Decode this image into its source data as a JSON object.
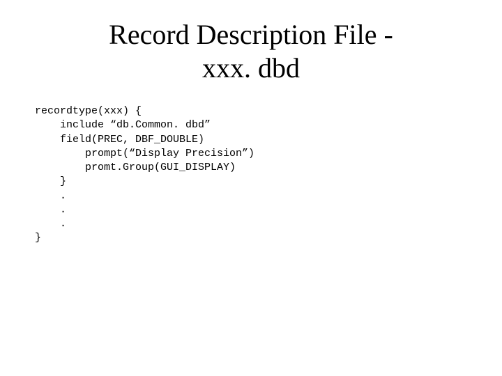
{
  "title_line1": "Record Description File -",
  "title_line2": "xxx. dbd",
  "code": {
    "l0": "recordtype(xxx) {",
    "l1": "    include “db.Common. dbd”",
    "l2": "    field(PREC, DBF_DOUBLE)",
    "l3": "        prompt(“Display Precision”)",
    "l4": "        promt.Group(GUI_DISPLAY)",
    "l5": "    }",
    "l6": "    .",
    "l7": "    .",
    "l8": "    .",
    "l9": "}"
  }
}
